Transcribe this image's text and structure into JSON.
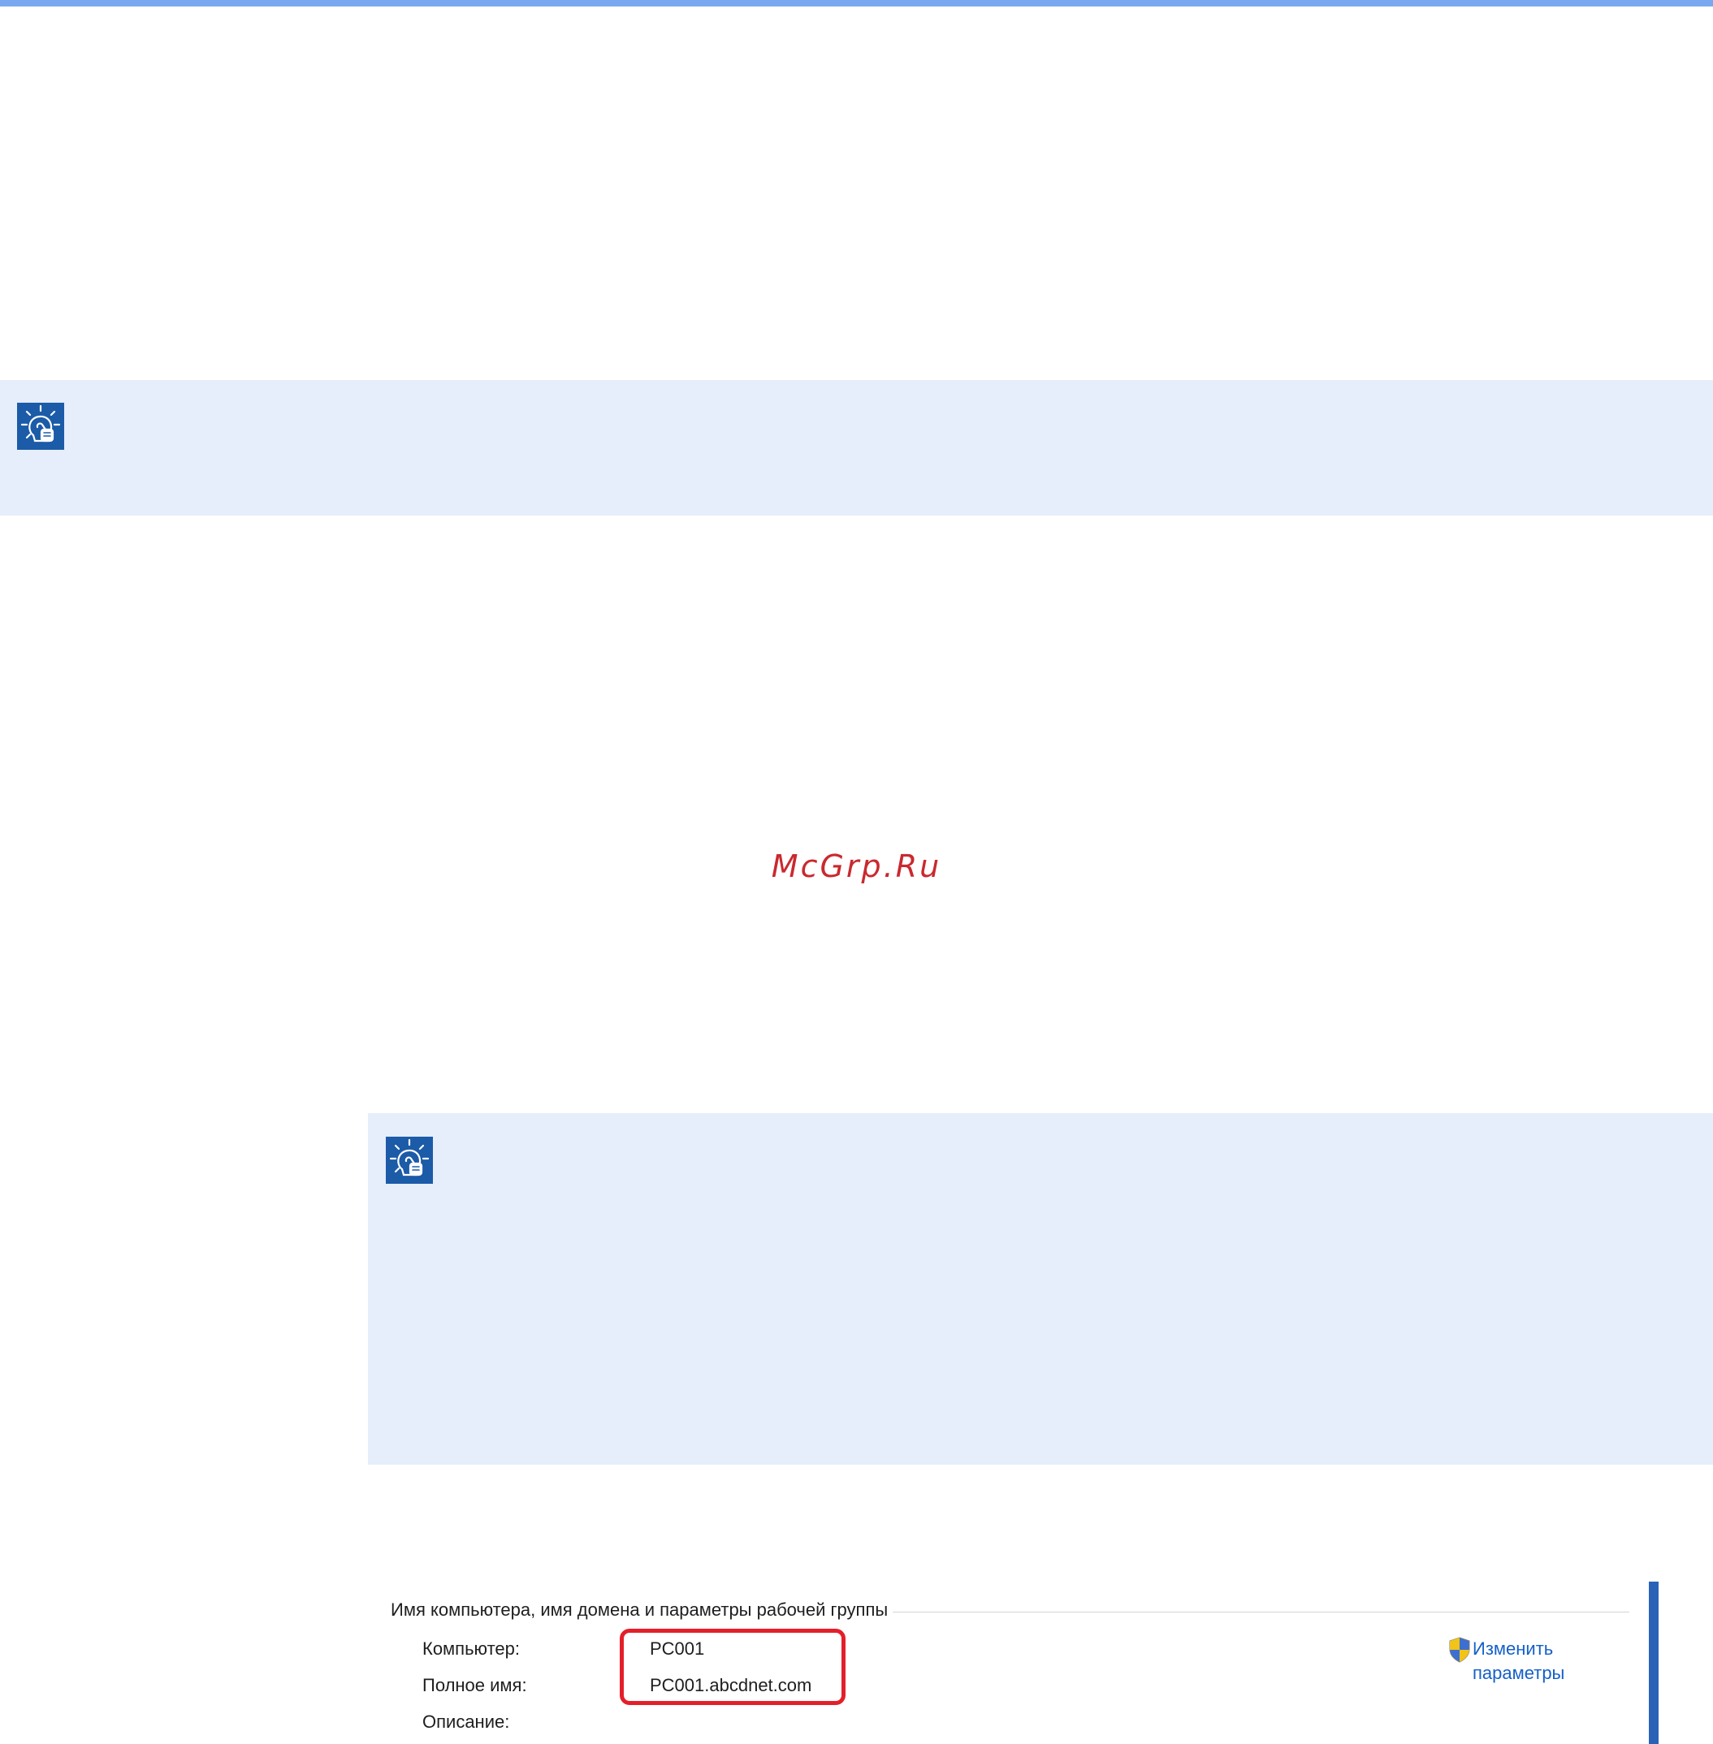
{
  "watermark": {
    "text": "McGrp.Ru"
  },
  "notes": [
    {
      "icon": "lightbulb-hint-icon"
    },
    {
      "icon": "lightbulb-hint-icon"
    }
  ],
  "system_properties": {
    "group_title": "Имя компьютера, имя домена и параметры рабочей группы",
    "rows": [
      {
        "label": "Компьютер:",
        "value": "PC001"
      },
      {
        "label": "Полное имя:",
        "value": "PC001.abcdnet.com"
      },
      {
        "label": "Описание:",
        "value": ""
      }
    ],
    "change_link": {
      "line1": "Изменить",
      "line2": "параметры",
      "icon": "uac-shield-icon"
    }
  },
  "colors": {
    "top_rule": "#7aa8f0",
    "note_background": "#e6edfb",
    "note_icon": "#1b5ba8",
    "highlight_border": "#e3202a",
    "link": "#1560c9",
    "watermark": "#c9292f"
  }
}
